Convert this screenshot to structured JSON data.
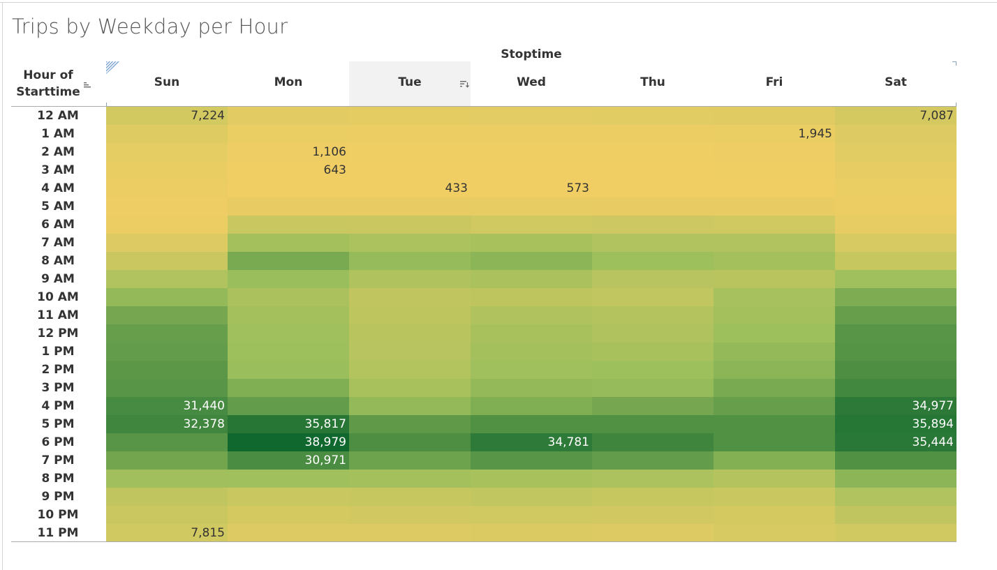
{
  "title": "Trips by Weekday per Hour",
  "column_group_title": "Stoptime",
  "row_header_title_line1": "Hour of",
  "row_header_title_line2": "Starttime",
  "icons": {
    "row_sort": "sort-icon",
    "column_sort": "sort-descending-icon",
    "corner": "corner-marker-icon"
  },
  "colors": {
    "low": "#f1ce64",
    "mid": "#9cbf5c",
    "high": "#10682f",
    "selected_header_bg": "#f2f2f2"
  },
  "chart_data": {
    "type": "heatmap",
    "title": "Trips by Weekday per Hour",
    "x_title": "Stoptime",
    "y_title": "Hour of Starttime",
    "columns": [
      "Sun",
      "Mon",
      "Tue",
      "Wed",
      "Thu",
      "Fri",
      "Sat"
    ],
    "rows": [
      "12 AM",
      "1 AM",
      "2 AM",
      "3 AM",
      "4 AM",
      "5 AM",
      "6 AM",
      "7 AM",
      "8 AM",
      "9 AM",
      "10 AM",
      "11 AM",
      "12 PM",
      "1 PM",
      "2 PM",
      "3 PM",
      "4 PM",
      "5 PM",
      "6 PM",
      "7 PM",
      "8 PM",
      "9 PM",
      "10 PM",
      "11 PM"
    ],
    "values": [
      [
        7224,
        3700,
        3300,
        3500,
        4000,
        4500,
        7087
      ],
      [
        4800,
        2000,
        1500,
        1600,
        1700,
        1945,
        5000
      ],
      [
        3200,
        1106,
        800,
        850,
        900,
        1100,
        4000
      ],
      [
        2200,
        643,
        500,
        550,
        600,
        800,
        3000
      ],
      [
        1500,
        600,
        433,
        573,
        600,
        700,
        2000
      ],
      [
        1200,
        2500,
        2400,
        2600,
        2500,
        2400,
        1600
      ],
      [
        1700,
        9500,
        9000,
        8000,
        8500,
        8000,
        2600
      ],
      [
        5000,
        18000,
        16000,
        17000,
        15000,
        15000,
        6000
      ],
      [
        9000,
        24500,
        20500,
        22000,
        19500,
        18000,
        10000
      ],
      [
        15000,
        20000,
        15500,
        16500,
        13500,
        13000,
        19000
      ],
      [
        21000,
        16500,
        11500,
        12000,
        11000,
        17500,
        24000
      ],
      [
        25000,
        18000,
        12000,
        15500,
        14000,
        18000,
        27000
      ],
      [
        27000,
        19000,
        13000,
        17000,
        15500,
        19500,
        29000
      ],
      [
        27500,
        19500,
        13500,
        18000,
        17000,
        21000,
        29500
      ],
      [
        28500,
        20000,
        14500,
        19000,
        19500,
        22000,
        30500
      ],
      [
        29000,
        23500,
        17000,
        21000,
        20500,
        24500,
        32000
      ],
      [
        31440,
        27500,
        21000,
        23500,
        25000,
        27000,
        34977
      ],
      [
        32378,
        35817,
        28000,
        30000,
        30000,
        30000,
        35894
      ],
      [
        29000,
        38979,
        30500,
        34781,
        32500,
        30000,
        35444
      ],
      [
        25500,
        30971,
        26000,
        29000,
        27500,
        23000,
        30000
      ],
      [
        18500,
        19000,
        18000,
        17000,
        16000,
        14000,
        22000
      ],
      [
        11500,
        9500,
        10000,
        11000,
        10000,
        9500,
        15000
      ],
      [
        9000,
        7000,
        7500,
        8000,
        7500,
        7000,
        11500
      ],
      [
        7815,
        5000,
        5000,
        5500,
        5000,
        6000,
        8000
      ]
    ],
    "labeled_cells": [
      {
        "row": 0,
        "col": 0,
        "label": "7,224"
      },
      {
        "row": 0,
        "col": 6,
        "label": "7,087"
      },
      {
        "row": 1,
        "col": 5,
        "label": "1,945"
      },
      {
        "row": 2,
        "col": 1,
        "label": "1,106"
      },
      {
        "row": 3,
        "col": 1,
        "label": "643"
      },
      {
        "row": 4,
        "col": 2,
        "label": "433"
      },
      {
        "row": 4,
        "col": 3,
        "label": "573"
      },
      {
        "row": 16,
        "col": 0,
        "label": "31,440"
      },
      {
        "row": 16,
        "col": 6,
        "label": "34,977"
      },
      {
        "row": 17,
        "col": 0,
        "label": "32,378"
      },
      {
        "row": 17,
        "col": 1,
        "label": "35,817"
      },
      {
        "row": 17,
        "col": 6,
        "label": "35,894"
      },
      {
        "row": 18,
        "col": 1,
        "label": "38,979"
      },
      {
        "row": 18,
        "col": 3,
        "label": "34,781"
      },
      {
        "row": 18,
        "col": 6,
        "label": "35,444"
      },
      {
        "row": 19,
        "col": 1,
        "label": "30,971"
      },
      {
        "row": 23,
        "col": 0,
        "label": "7,815"
      }
    ],
    "selected_column": "Tue",
    "color_scale": [
      "#f1ce64",
      "#9cbf5c",
      "#10682f"
    ]
  }
}
